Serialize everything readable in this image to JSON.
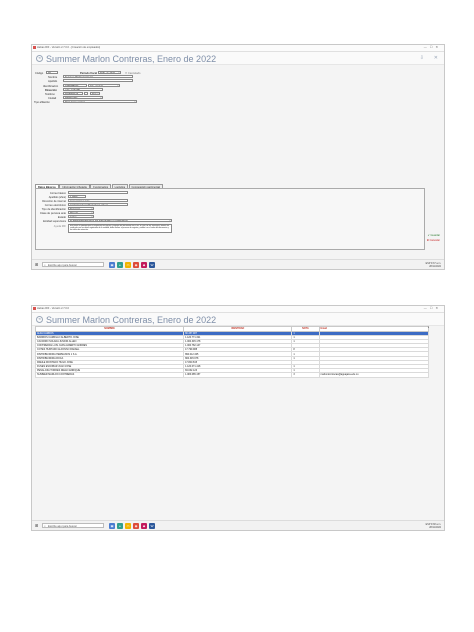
{
  "window": {
    "title": "Hebas RIF - Versión 2.7.0.0 - [Creación de empleados]",
    "title2": "Hebas RIF - Versión 2.7.0.0",
    "header_title": "Summer Marlon Contreras, Enero de 2022"
  },
  "form": {
    "codigo_label": "Código",
    "codigo_value": "38",
    "periodo_label": "Periodo fiscal",
    "periodo_value": "ENE. de 2022",
    "cancelado_label": "Cancelado",
    "nombre_label": "Nombre",
    "nombre_value": "Summer Marlon Contreras",
    "apellido_label": "Apellido",
    "nit_label": "Identificación",
    "nit_value": "1083085157",
    "tipo_doc_value": "CC - Cédula",
    "direccion_label": "Dirección",
    "direccion_value": "calle 1 N°4AB",
    "telefono_label": "Teléfono",
    "telefono_value": "3018097113",
    "pais_value": "Pais",
    "ciudad_label": "Ciudad",
    "ciudad_value": "RIOHACHA",
    "tipo_empresa_label": "Tipo afiliación",
    "tipo_empresa_value": "Para Consecutivos"
  },
  "tabs": [
    "Datos Básicos",
    "Información tributaria",
    "Funcionarios",
    "Logística",
    "Composición patrimonial"
  ],
  "details": {
    "rows": [
      {
        "label": "Correo básico",
        "value": ""
      },
      {
        "label": "Apellido (años)",
        "value": "1.0000"
      },
      {
        "label": "Dirección de internet",
        "value": "www.summer.com"
      },
      {
        "label": "Correo electrónico",
        "value": "marlontcontreras@aguajaca.edu.co"
      },
      {
        "label": "Tipo de identificación",
        "value": "Numérico"
      },
      {
        "label": "Clase de persona ante",
        "value": "Privado"
      },
      {
        "label": "Estado",
        "value": "Activo"
      },
      {
        "label": "Entidad supervisora",
        "value": "SUPERINTENDENCIA DE INDUSTRIA Y COMERCIO"
      }
    ],
    "note_label": "Ayuda RIF",
    "note_text": "Esta tiene la habilidad para la respectiva inscripción y registro del documento en el RIF. El cual, de ser necesario, deberá ser verificado con los datos registrados de la entidad, debe realizar el proceso de registro y validar con el valor del documento y las tablas de retención."
  },
  "side_buttons": [
    {
      "label": "Guardar"
    },
    {
      "label": "Cancelar"
    }
  ],
  "taskbar": {
    "search_placeholder": "Escribe aquí para buscar",
    "tray_text": "ESP  9:37 a.m.",
    "tray_date": "28/11/2022",
    "tray_text2": "ESP  9:38 a.m.",
    "tray_date2": "28/11/2022"
  },
  "grid": {
    "columns": [
      "NOMBRE",
      "IDENTIDAD",
      "NOTA",
      "Email"
    ],
    "rows": [
      [
        "ALFA CARROS",
        "80.457.987",
        "1",
        ""
      ],
      [
        "BARRIOS CARRILLO ALBERTO JOSE",
        "1.120.771.321",
        "1",
        ""
      ],
      [
        "CAYARRO SOLANA JUNIOR ALLEN",
        "1.000.345.178",
        "1",
        ""
      ],
      [
        "CONTRERAS LUIS JUAN ALBERTO ANDRES",
        "1.000.782.147",
        "",
        ""
      ],
      [
        "COTES HURTADO ALFONSO RAFAEL",
        "17.799.988",
        "8",
        ""
      ],
      [
        "DISTRIBUIDORA HERMANOS 1 S.A.",
        "890.012.345",
        "1",
        ""
      ],
      [
        "DISTRIBUIDORA ROCA",
        "800.345.678",
        "1",
        ""
      ],
      [
        "FREILE MONTANO HUGO JOSE",
        "17.800.815",
        "",
        ""
      ],
      [
        "FUNES ESCOBAR JUAN JOSE",
        "1.120.071.418",
        "1",
        ""
      ],
      [
        "PEÑALOZA TORRES DIEGO ENRIQUE",
        "84.032.123",
        "1",
        ""
      ],
      [
        "SUMMER MARLON CONTRERAS",
        "1.083.085.157",
        "3",
        "marlontcontreras@aguajaca.edu.co"
      ]
    ]
  },
  "colors": {
    "header_title": "#7f8fa8",
    "grid_header": "#c0392b",
    "selection": "#3d6cc4"
  }
}
